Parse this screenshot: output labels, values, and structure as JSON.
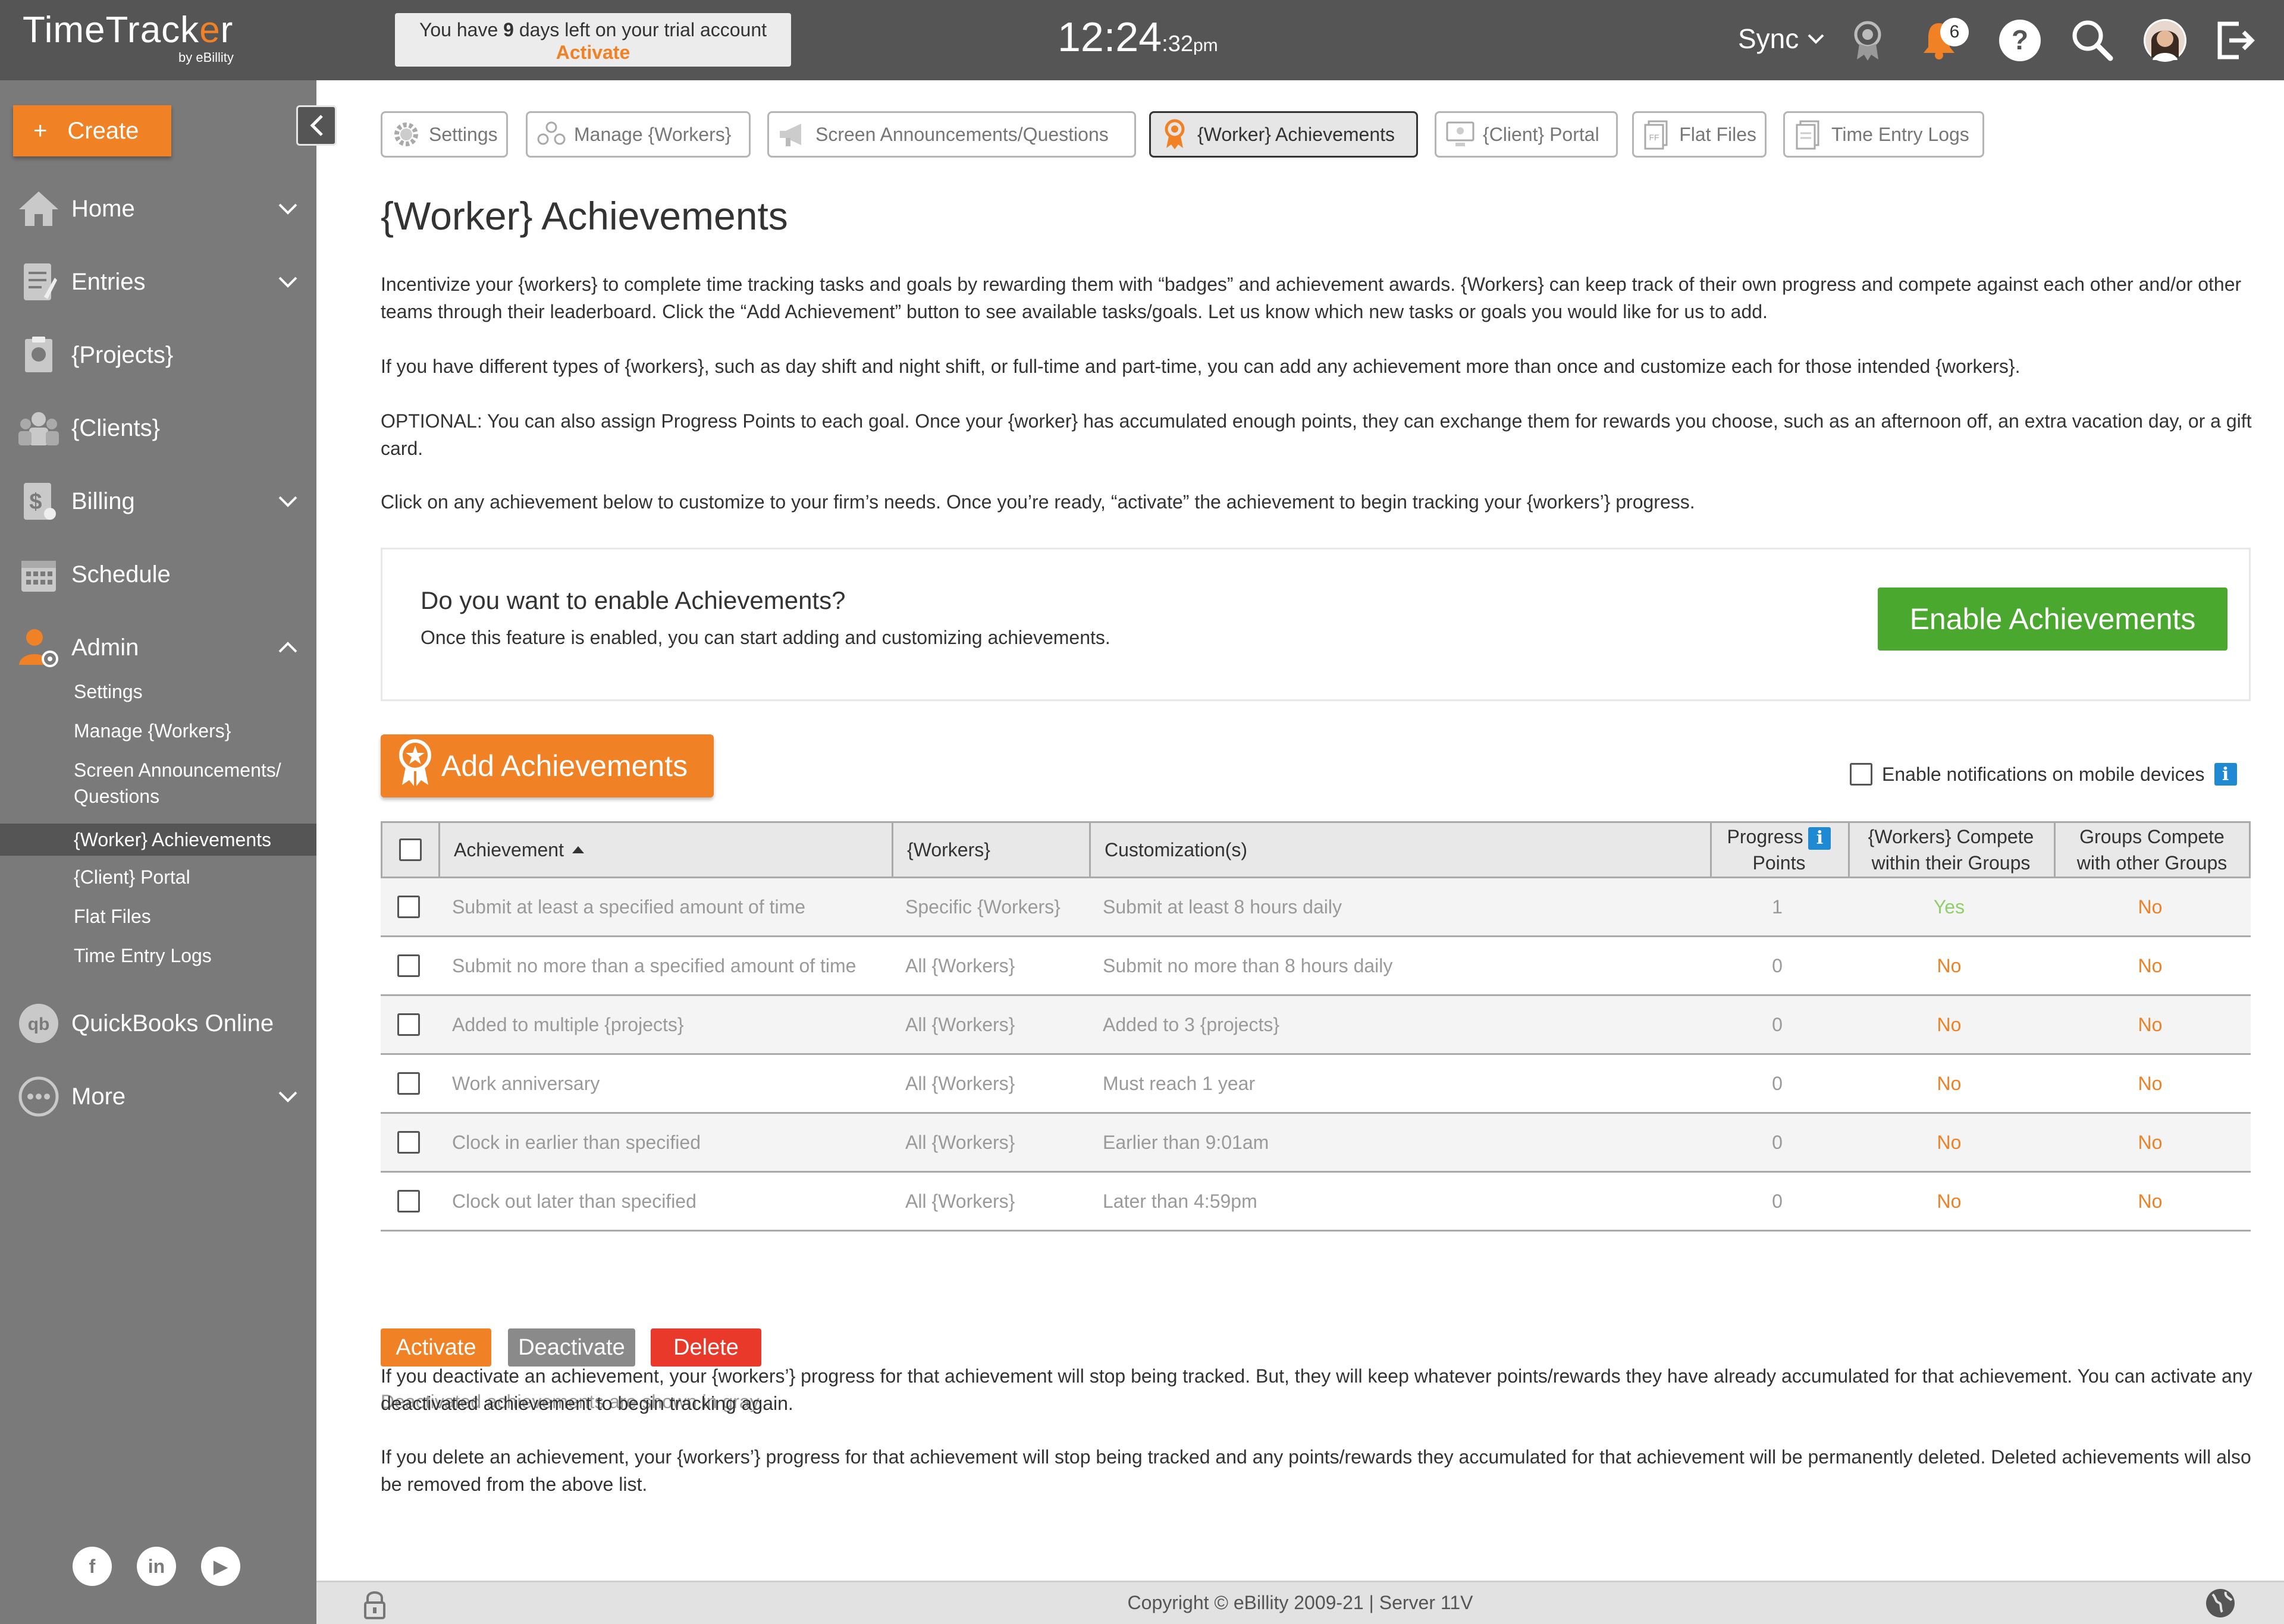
{
  "app": {
    "name_pre": "TimeTrack",
    "name_o": "e",
    "name_post": "r",
    "by": "by eBillity"
  },
  "trial": {
    "prefix": "You have ",
    "days": "9",
    "suffix": " days left on your trial account",
    "activate_label": "Activate"
  },
  "clock": {
    "hm": "12:24",
    "sec": ":32",
    "ampm": "pm"
  },
  "topbar": {
    "sync_label": "Sync",
    "notification_count": "6"
  },
  "sidebar": {
    "create_label": "Create",
    "create_plus": "+",
    "nav": [
      {
        "label": "Home",
        "icon": "home-icon"
      },
      {
        "label": "Entries",
        "icon": "entries-icon"
      },
      {
        "label": "{Projects}",
        "icon": "projects-icon"
      },
      {
        "label": "{Clients}",
        "icon": "clients-icon"
      },
      {
        "label": "Billing",
        "icon": "billing-icon"
      },
      {
        "label": "Schedule",
        "icon": "calendar-icon"
      },
      {
        "label": "Admin",
        "icon": "admin-icon"
      },
      {
        "label": "QuickBooks Online",
        "icon": "quickbooks-icon"
      },
      {
        "label": "More",
        "icon": "more-icon"
      }
    ],
    "admin_sub": [
      {
        "label": "Settings"
      },
      {
        "label": "Manage {Workers}"
      },
      {
        "label": "Screen Announcements/",
        "label2": "Questions"
      },
      {
        "label": "{Worker} Achievements"
      },
      {
        "label": "{Client} Portal"
      },
      {
        "label": "Flat Files"
      },
      {
        "label": "Time Entry Logs"
      }
    ],
    "social": {
      "facebook": "f",
      "linkedin": "in",
      "youtube": "▶"
    }
  },
  "tabs": [
    {
      "label": "Settings",
      "icon": "gear-icon"
    },
    {
      "label": "Manage {Workers}",
      "icon": "workers-icon"
    },
    {
      "label": "Screen Announcements/Questions",
      "icon": "megaphone-icon"
    },
    {
      "label": "{Worker} Achievements",
      "icon": "achievement-icon"
    },
    {
      "label": "{Client} Portal",
      "icon": "portal-icon"
    },
    {
      "label": "Flat Files",
      "icon": "flat-files-icon"
    },
    {
      "label": "Time Entry Logs",
      "icon": "time-entry-logs-icon"
    }
  ],
  "page": {
    "title": "{Worker} Achievements",
    "p1": "Incentivize your {workers} to complete time tracking tasks and goals by rewarding them with “badges” and achievement awards. {Workers} can keep track of their own progress and compete against each other and/or other teams through their leaderboard. Click the “Add Achievement” button to see available tasks/goals. Let us know which new tasks or goals you would like for us to add.",
    "p2": "If you have different types of {workers}, such as day shift and night shift, or full-time and part-time, you can add any achievement more than once and customize each for those intended {workers}.",
    "p3": "OPTIONAL: You can also assign Progress Points to each goal. Once your {worker} has accumulated enough points, they can exchange them for rewards you choose, such as an afternoon off, an extra vacation day, or a gift card.",
    "p4": "Click on any achievement below to customize to your firm’s needs. Once you’re ready, “activate” the achievement to begin tracking your {workers’} progress."
  },
  "enable": {
    "question": "Do you want to enable Achievements?",
    "description": "Once this feature is enabled, you can start adding and customizing achievements.",
    "button": "Enable Achievements"
  },
  "add_button": "Add Achievements",
  "notifications_label": "Enable notifications on mobile devices",
  "table": {
    "headers": {
      "achievement": "Achievement",
      "workers": "{Workers}",
      "customization": "Customization(s)",
      "points_l1": "Progress",
      "points_l2": "Points",
      "compete_within_l1": "{Workers} Compete",
      "compete_within_l2": "within their Groups",
      "compete_other_l1": "Groups Compete",
      "compete_other_l2": "with other Groups"
    },
    "rows": [
      {
        "achievement": "Submit at least a specified amount of time",
        "workers": "Specific {Workers}",
        "customization": "Submit at least 8 hours daily",
        "points": "1",
        "within": "Yes",
        "other": "No"
      },
      {
        "achievement": "Submit no more than a specified amount of time",
        "workers": "All {Workers}",
        "customization": "Submit no more than 8 hours daily",
        "points": "0",
        "within": "No",
        "other": "No"
      },
      {
        "achievement": "Added to multiple {projects}",
        "workers": "All {Workers}",
        "customization": "Added to 3 {projects}",
        "points": "0",
        "within": "No",
        "other": "No"
      },
      {
        "achievement": "Work anniversary",
        "workers": "All {Workers}",
        "customization": "Must reach 1 year",
        "points": "0",
        "within": "No",
        "other": "No"
      },
      {
        "achievement": "Clock in earlier than specified",
        "workers": "All {Workers}",
        "customization": "Earlier than 9:01am",
        "points": "0",
        "within": "No",
        "other": "No"
      },
      {
        "achievement": "Clock out later than specified",
        "workers": "All {Workers}",
        "customization": "Later than 4:59pm",
        "points": "0",
        "within": "No",
        "other": "No"
      }
    ]
  },
  "actions": {
    "activate": "Activate",
    "deactivate": "Deactivate",
    "delete": "Delete"
  },
  "notes": {
    "gray": "Deactivated achievements are shown in gray.",
    "deactivate": "If you deactivate an achievement, your {workers’} progress for that achievement will stop being tracked. But, they will keep whatever points/rewards they have already accumulated for that achievement. You can activate any deactivated achievement to begin tracking again.",
    "delete": "If you delete an achievement, your {workers’} progress for that achievement will stop being tracked and any points/rewards they accumulated for that achievement will be permanently deleted. Deleted achievements will also be removed from the above list."
  },
  "footer": {
    "copyright": "Copyright © eBillity 2009-21 | Server 11V"
  },
  "colors": {
    "accent": "#f08125",
    "enable": "#4aa82e",
    "delete": "#e8392a",
    "sidebar": "#7a7a7a",
    "topbar": "#555555"
  }
}
